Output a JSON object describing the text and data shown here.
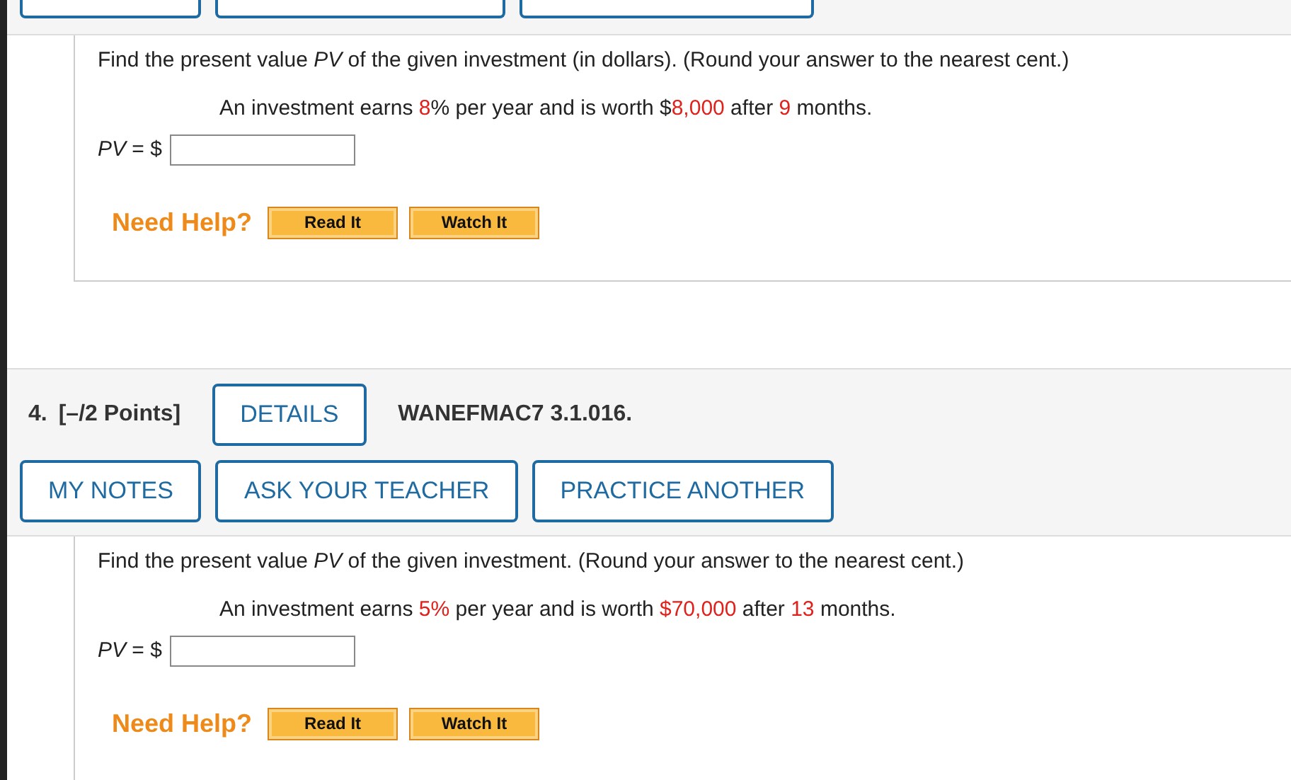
{
  "questions": [
    {
      "prompt": "Find the present value *PV* of the given investment (in dollars). (Round your answer to the nearest cent.)",
      "statement": [
        {
          "text": "An investment earns ",
          "emphasis": false
        },
        {
          "text": "8",
          "emphasis": true
        },
        {
          "text": "% per year and is worth $",
          "emphasis": false
        },
        {
          "text": "8,000",
          "emphasis": true
        },
        {
          "text": " after ",
          "emphasis": false
        },
        {
          "text": "9",
          "emphasis": true
        },
        {
          "text": " months.",
          "emphasis": false
        }
      ],
      "answer_label": "*PV* = $",
      "help_label": "Need Help?",
      "help_buttons": [
        "Read It",
        "Watch It"
      ]
    },
    {
      "number": "4.",
      "points": "[–/2 Points]",
      "details": "DETAILS",
      "code": "WANEFMAC7 3.1.016.",
      "actions": [
        "MY NOTES",
        "ASK YOUR TEACHER",
        "PRACTICE ANOTHER"
      ],
      "prompt": "Find the present value *PV* of the given investment. (Round your answer to the nearest cent.)",
      "statement": [
        {
          "text": "An investment earns ",
          "emphasis": false
        },
        {
          "text": "5%",
          "emphasis": true
        },
        {
          "text": " per year and is worth ",
          "emphasis": false
        },
        {
          "text": "$70,000",
          "emphasis": true
        },
        {
          "text": " after ",
          "emphasis": false
        },
        {
          "text": "13",
          "emphasis": true
        },
        {
          "text": " months.",
          "emphasis": false
        }
      ],
      "answer_label": "*PV* = $",
      "help_label": "Need Help?",
      "help_buttons": [
        "Read It",
        "Watch It"
      ]
    }
  ]
}
